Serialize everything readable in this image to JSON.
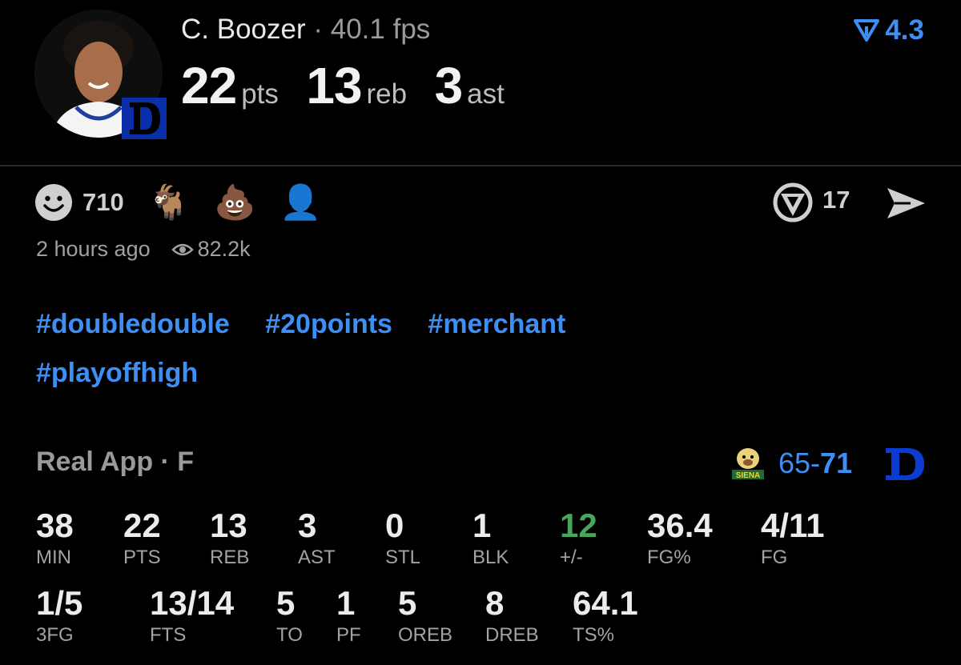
{
  "player": {
    "name": "C. Boozer",
    "separator": "·",
    "fps": "40.1 fps",
    "pts_value": "22",
    "pts_label": "pts",
    "reb_value": "13",
    "reb_label": "reb",
    "ast_value": "3",
    "ast_label": "ast",
    "avatar_icon": "player-headshot",
    "team_logo_icon": "duke-d-logo"
  },
  "rating": {
    "value": "4.3",
    "icon": "real-rating-icon",
    "color": "#3d8ff5"
  },
  "reactions": {
    "smile_icon": "smiley-icon",
    "count": "710",
    "emojis": [
      "🐐",
      "💩",
      "👤"
    ],
    "emoji_icons": [
      "goat-emoji",
      "poop-emoji",
      "lebron-emoji"
    ]
  },
  "replies": {
    "count": "17",
    "icon": "reply-icon"
  },
  "share_icon": "send-icon",
  "meta": {
    "time": "2 hours ago",
    "views": "82.2k",
    "eye_icon": "eye-icon"
  },
  "hashtags": [
    "#doubledouble",
    "#20points",
    "#merchant",
    "#playoffhigh"
  ],
  "game": {
    "title": "Real App · F",
    "opponent_logo": "siena-logo",
    "away_score": "65",
    "dash": "-",
    "home_score": "71",
    "home_logo": "duke-d-logo"
  },
  "stats_row1": [
    {
      "value": "38",
      "label": "MIN"
    },
    {
      "value": "22",
      "label": "PTS"
    },
    {
      "value": "13",
      "label": "REB"
    },
    {
      "value": "3",
      "label": "AST"
    },
    {
      "value": "0",
      "label": "STL"
    },
    {
      "value": "1",
      "label": "BLK"
    },
    {
      "value": "12",
      "label": "+/-"
    },
    {
      "value": "36.4",
      "label": "FG%"
    },
    {
      "value": "4/11",
      "label": "FG"
    }
  ],
  "stats_row2": [
    {
      "value": "1/5",
      "label": "3FG"
    },
    {
      "value": "13/14",
      "label": "FTS"
    },
    {
      "value": "5",
      "label": "TO"
    },
    {
      "value": "1",
      "label": "PF"
    },
    {
      "value": "5",
      "label": "OREB"
    },
    {
      "value": "8",
      "label": "DREB"
    },
    {
      "value": "64.1",
      "label": "TS%"
    }
  ],
  "colors": {
    "accent": "#3d8ff5",
    "positive": "#46a759",
    "background": "#000000"
  }
}
